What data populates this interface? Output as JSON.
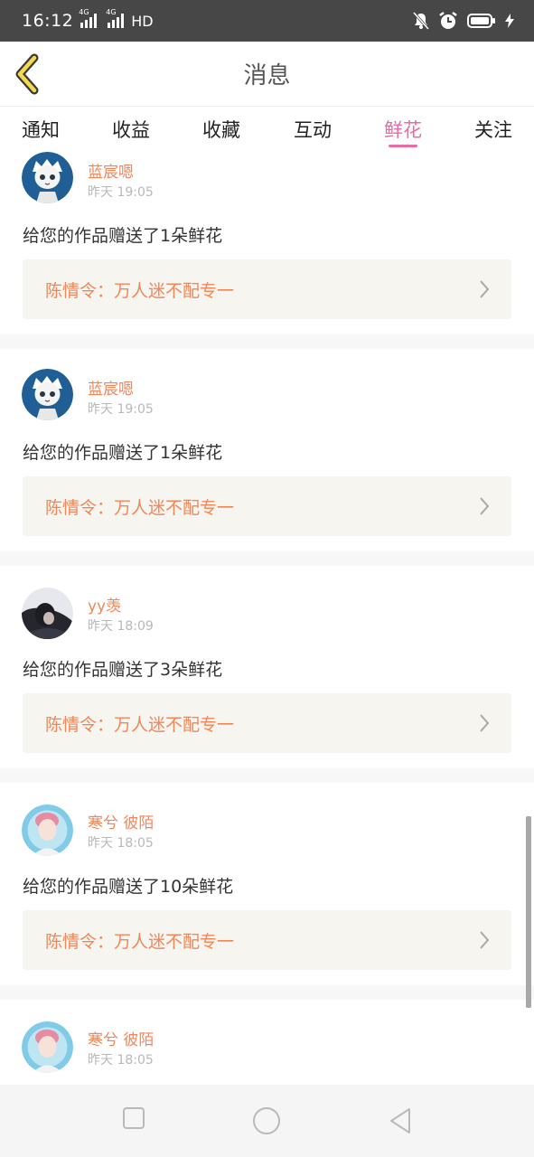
{
  "status": {
    "time": "16:12",
    "sig1": "4G",
    "sig2": "4G",
    "hd": "HD"
  },
  "header": {
    "title": "消息"
  },
  "tabs": [
    {
      "label": "通知"
    },
    {
      "label": "收益"
    },
    {
      "label": "收藏"
    },
    {
      "label": "互动"
    },
    {
      "label": "鲜花"
    },
    {
      "label": "关注"
    }
  ],
  "active_tab": "鲜花",
  "colors": {
    "accent_pink": "#e96aa4",
    "orange_text": "#f0875a",
    "work_bg": "#f6f5ef"
  },
  "items": [
    {
      "username": "蓝宸嗯",
      "time": "昨天 19:05",
      "message": "给您的作品赠送了1朵鲜花",
      "work": "陈情令：万人迷不配专一",
      "avatar": "anime-avatar"
    },
    {
      "username": "蓝宸嗯",
      "time": "昨天 19:05",
      "message": "给您的作品赠送了1朵鲜花",
      "work": "陈情令：万人迷不配专一",
      "avatar": "anime-avatar"
    },
    {
      "username": "yy羡",
      "time": "昨天 18:09",
      "message": "给您的作品赠送了3朵鲜花",
      "work": "陈情令：万人迷不配专一",
      "avatar": "photo-avatar-dark"
    },
    {
      "username": "寒兮 彼陌",
      "time": "昨天 18:05",
      "message": "给您的作品赠送了10朵鲜花",
      "work": "陈情令：万人迷不配专一",
      "avatar": "photo-avatar-pink"
    },
    {
      "username": "寒兮 彼陌",
      "time": "昨天 18:05",
      "avatar": "photo-avatar-pink"
    }
  ],
  "navbar": {
    "icons": [
      "square-icon",
      "circle-icon",
      "triangle-back-icon"
    ]
  }
}
